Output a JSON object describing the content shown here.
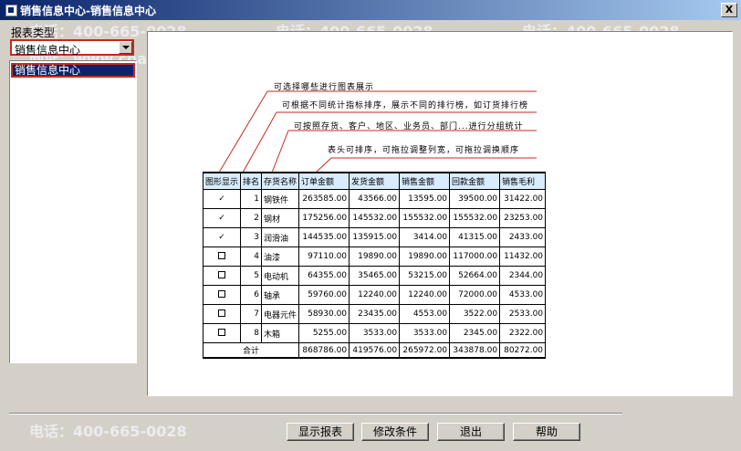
{
  "window": {
    "title": "销售信息中心-销售信息中心",
    "close_label": "X"
  },
  "left": {
    "report_type_label": "报表类型",
    "combo_value": "销售信息中心",
    "list_items": [
      "销售信息中心"
    ]
  },
  "panel": {
    "notes": [
      "可选择哪些进行图表展示",
      "可根据不同统计指标排序，展示不同的排行榜，如订货排行榜",
      "可按照存货、客户、地区、业务员、部门...进行分组统计",
      "表头可排序，可拖拉调整列宽，可拖拉调换顺序"
    ],
    "table": {
      "headers": [
        "图形显示",
        "排名",
        "存货名称",
        "订单金额",
        "发货金额",
        "销售金额",
        "回款金额",
        "销售毛利"
      ],
      "rows": [
        {
          "check": "✓",
          "rank": "1",
          "name": "钢铁件",
          "order": "263585.00",
          "ship": "43566.00",
          "sale": "13595.00",
          "pay": "39500.00",
          "profit": "31422.00"
        },
        {
          "check": "✓",
          "rank": "2",
          "name": "钢材",
          "order": "175256.00",
          "ship": "145532.00",
          "sale": "155532.00",
          "pay": "155532.00",
          "profit": "23253.00"
        },
        {
          "check": "✓",
          "rank": "3",
          "name": "润滑油",
          "order": "144535.00",
          "ship": "135915.00",
          "sale": "3414.00",
          "pay": "41315.00",
          "profit": "2433.00"
        },
        {
          "check": "",
          "rank": "4",
          "name": "油漆",
          "order": "97110.00",
          "ship": "19890.00",
          "sale": "19890.00",
          "pay": "117000.00",
          "profit": "11432.00"
        },
        {
          "check": "",
          "rank": "5",
          "name": "电动机",
          "order": "64355.00",
          "ship": "35465.00",
          "sale": "53215.00",
          "pay": "52664.00",
          "profit": "2344.00"
        },
        {
          "check": "",
          "rank": "6",
          "name": "轴承",
          "order": "59760.00",
          "ship": "12240.00",
          "sale": "12240.00",
          "pay": "72000.00",
          "profit": "4533.00"
        },
        {
          "check": "",
          "rank": "7",
          "name": "电器元件",
          "order": "58930.00",
          "ship": "23435.00",
          "sale": "4553.00",
          "pay": "3522.00",
          "profit": "2533.00"
        },
        {
          "check": "",
          "rank": "8",
          "name": "木箱",
          "order": "5255.00",
          "ship": "3533.00",
          "sale": "3533.00",
          "pay": "2345.00",
          "profit": "2322.00"
        }
      ],
      "total_label": "合计",
      "totals": {
        "order": "868786.00",
        "ship": "419576.00",
        "sale": "265972.00",
        "pay": "343878.00",
        "profit": "80272.00"
      }
    }
  },
  "buttons": {
    "show": "显示报表",
    "modify": "修改条件",
    "exit": "退出",
    "help": "帮助"
  },
  "watermark": {
    "phone": "电话：400-665-0028",
    "site": "网址：www.chanjet.net"
  },
  "colors": {
    "titlebar_start": "#0a246a",
    "titlebar_end": "#a6caf0",
    "highlight_border": "#c8281e",
    "table_header": "#d8ecff"
  }
}
